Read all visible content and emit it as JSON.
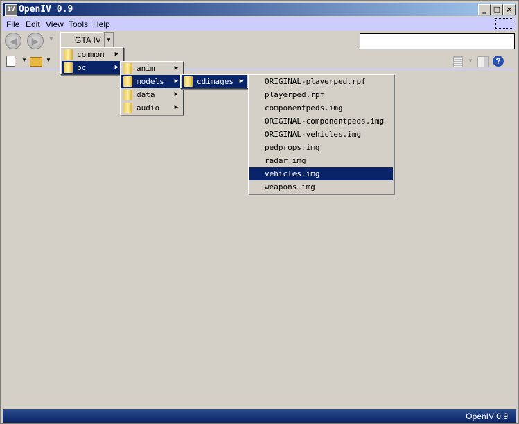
{
  "window": {
    "title": "OpenIV 0.9",
    "icon": "IV",
    "minimize": "_",
    "maximize": "□",
    "close": "×"
  },
  "menubar": [
    "File",
    "Edit",
    "View",
    "Tools",
    "Help"
  ],
  "toolbar": {
    "game_selector": "GTA IV",
    "back_icon": "back-icon",
    "forward_icon": "forward-icon"
  },
  "menus": {
    "level1": [
      {
        "label": "common"
      },
      {
        "label": "pc",
        "selected": true
      }
    ],
    "level2": [
      {
        "label": "anim"
      },
      {
        "label": "models",
        "selected": true
      },
      {
        "label": "data"
      },
      {
        "label": "audio"
      }
    ],
    "level3": [
      {
        "label": "cdimages",
        "selected": true
      }
    ],
    "files": [
      "ORIGINAL-playerped.rpf",
      "playerped.rpf",
      "componentpeds.img",
      "ORIGINAL-componentpeds.img",
      "ORIGINAL-vehicles.img",
      "pedprops.img",
      "radar.img",
      "vehicles.img",
      "weapons.img"
    ],
    "selected_file": "vehicles.img"
  },
  "status": {
    "text": "OpenIV 0.9"
  }
}
